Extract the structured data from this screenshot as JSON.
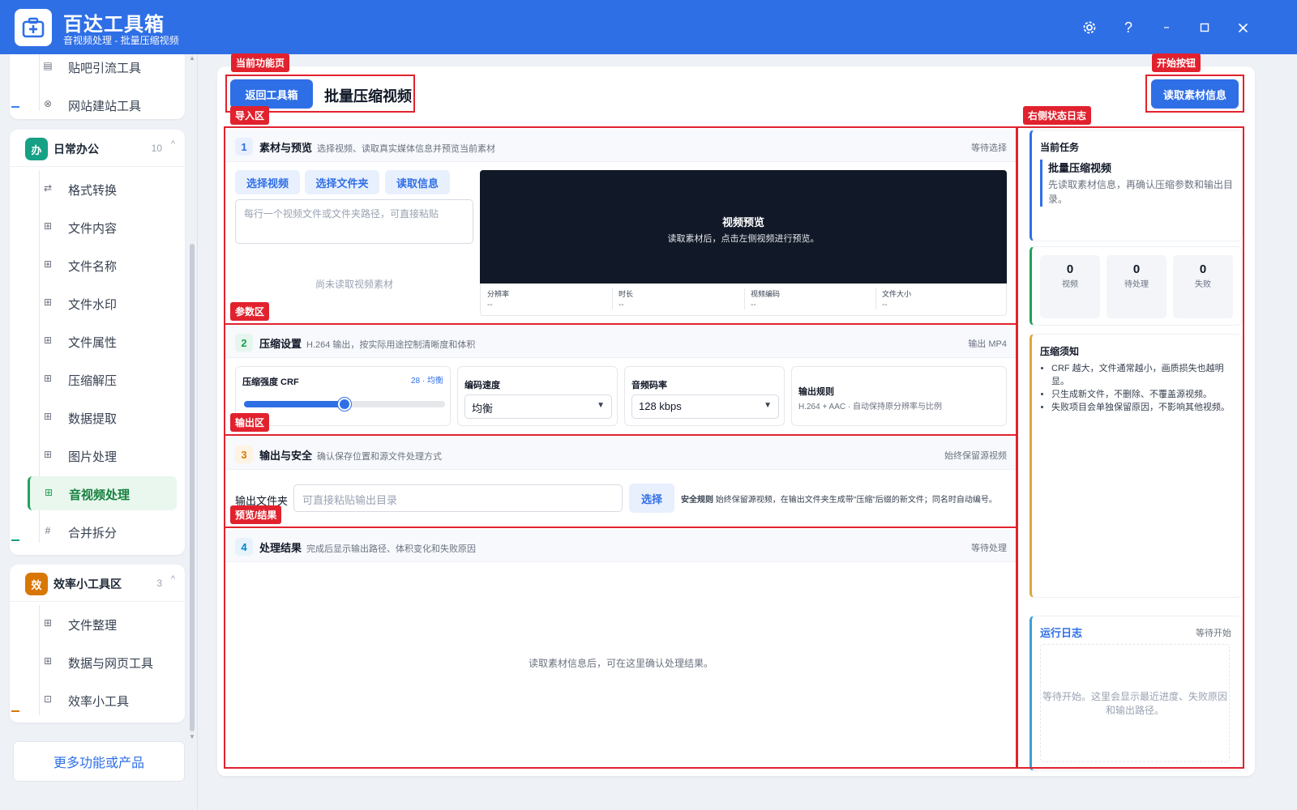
{
  "titlebar": {
    "title": "百达工具箱",
    "subtitle": "音视频处理 - 批量压缩视频",
    "icons": [
      "settings-gear-icon",
      "help-icon",
      "minimize-icon",
      "maximize-icon",
      "close-icon"
    ],
    "help_glyph": "?"
  },
  "sidebar": {
    "top_items": [
      {
        "label": "贴吧引流工具",
        "icon": "doc-icon"
      },
      {
        "label": "网站建站工具",
        "icon": "globe-icon"
      }
    ],
    "office_group": {
      "badge": "办",
      "title": "日常办公",
      "count": "10",
      "badge_color": "#16a085",
      "items": [
        {
          "label": "格式转换",
          "icon": "swap-icon"
        },
        {
          "label": "文件内容",
          "icon": "grid-icon"
        },
        {
          "label": "文件名称",
          "icon": "grid-icon"
        },
        {
          "label": "文件水印",
          "icon": "grid-icon"
        },
        {
          "label": "文件属性",
          "icon": "grid-icon"
        },
        {
          "label": "压缩解压",
          "icon": "grid-icon"
        },
        {
          "label": "数据提取",
          "icon": "grid-icon"
        },
        {
          "label": "图片处理",
          "icon": "grid-icon"
        },
        {
          "label": "音视频处理",
          "icon": "grid-icon",
          "active": true
        },
        {
          "label": "合并拆分",
          "icon": "hash-icon"
        }
      ]
    },
    "efficiency_group": {
      "badge": "效",
      "title": "效率小工具区",
      "count": "3",
      "badge_color": "#d97706",
      "items": [
        {
          "label": "文件整理",
          "icon": "grid-icon"
        },
        {
          "label": "数据与网页工具",
          "icon": "grid-icon"
        },
        {
          "label": "效率小工具",
          "icon": "toolbox-icon"
        }
      ]
    },
    "more_button": "更多功能或产品"
  },
  "header": {
    "back_button": "返回工具箱",
    "page_title": "批量压缩视频",
    "read_button": "读取素材信息"
  },
  "import_section": {
    "number": "1",
    "title": "素材与预览",
    "desc": "选择视频、读取真实媒体信息并预览当前素材",
    "status": "等待选择",
    "buttons": [
      "选择视频",
      "选择文件夹",
      "读取信息"
    ],
    "textarea_placeholder": "每行一个视频文件或文件夹路径，可直接粘贴",
    "empty_text": "尚未读取视频素材",
    "preview_title": "视频预览",
    "preview_hint": "读取素材后，点击左侧视频进行预览。",
    "meta": [
      {
        "label": "分辨率",
        "value": "--"
      },
      {
        "label": "时长",
        "value": "--"
      },
      {
        "label": "视频编码",
        "value": "--"
      },
      {
        "label": "文件大小",
        "value": "--"
      }
    ]
  },
  "params_section": {
    "number": "2",
    "title": "压缩设置",
    "desc": "H.264 输出，按实际用途控制清晰度和体积",
    "status": "输出 MP4",
    "crf_label": "压缩强度 CRF",
    "crf_value_text": "28 · 均衡",
    "crf_level": 0.5,
    "speed_label": "编码速度",
    "speed_value": "均衡",
    "audio_label": "音频码率",
    "audio_value": "128 kbps",
    "rule_label": "输出规则",
    "rule_text": "H.264 + AAC · 自动保持原分辨率与比例"
  },
  "output_section": {
    "number": "3",
    "title": "输出与安全",
    "desc": "确认保存位置和源文件处理方式",
    "status": "始终保留源视频",
    "folder_label": "输出文件夹",
    "folder_placeholder": "可直接粘贴输出目录",
    "choose_button": "选择",
    "safety_label": "安全规则",
    "safety_text": "始终保留源视频，在输出文件夹生成带\"压缩\"后缀的新文件；同名时自动编号。"
  },
  "result_section": {
    "number": "4",
    "title": "处理结果",
    "desc": "完成后显示输出路径、体积变化和失败原因",
    "status": "等待处理",
    "empty_text": "读取素材信息后，可在这里确认处理结果。"
  },
  "right_panel": {
    "task_label": "当前任务",
    "task_title": "批量压缩视频",
    "task_desc": "先读取素材信息，再确认压缩参数和输出目录。",
    "stats": [
      {
        "value": "0",
        "label": "视频"
      },
      {
        "value": "0",
        "label": "待处理"
      },
      {
        "value": "0",
        "label": "失败"
      }
    ],
    "notes_title": "压缩须知",
    "notes": [
      "CRF 越大，文件通常越小，画质损失也越明显。",
      "只生成新文件，不删除、不覆盖源视频。",
      "失败项目会单独保留原因，不影响其他视频。"
    ],
    "log_title": "运行日志",
    "log_status": "等待开始",
    "log_empty": "等待开始。这里会显示最近进度、失败原因和输出路径。"
  },
  "annotations": {
    "current_page": "当前功能页",
    "start_button": "开始按钮",
    "import_area": "导入区",
    "right_log": "右侧状态日志",
    "params_area": "参数区",
    "output_area": "输出区",
    "result_area": "预览/结果"
  },
  "colors": {
    "accent": "#2f6fe6",
    "annotation": "#e1222e",
    "active_nav": "#22a05b"
  }
}
